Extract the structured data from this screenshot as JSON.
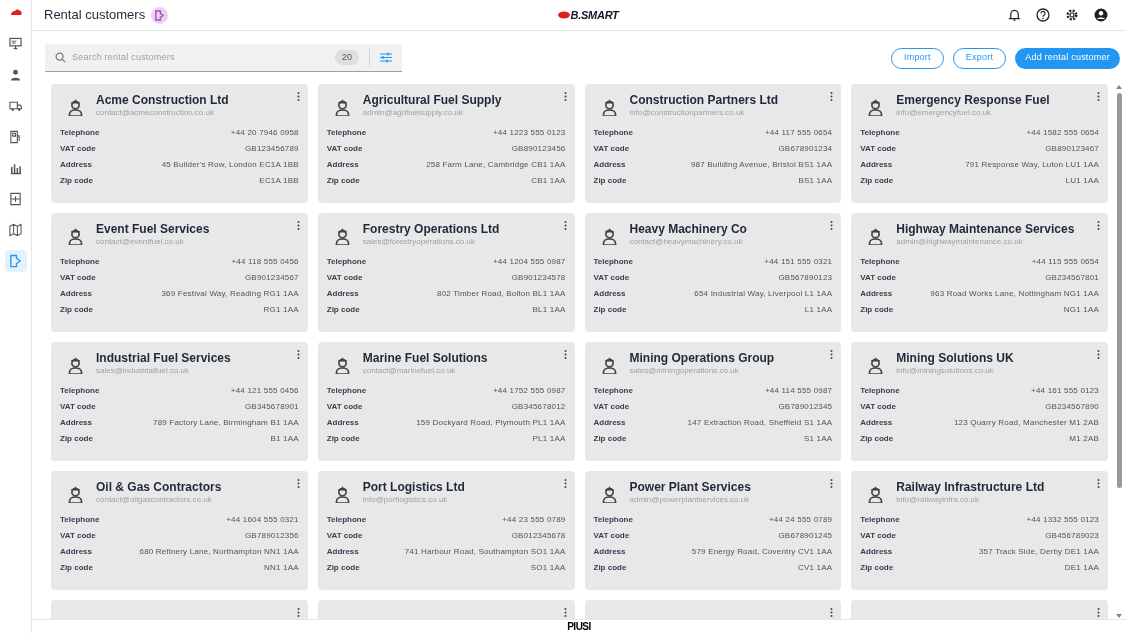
{
  "sidebar": {
    "items": [
      {
        "selected": false
      },
      {
        "selected": false
      },
      {
        "selected": false
      },
      {
        "selected": false
      },
      {
        "selected": false
      },
      {
        "selected": false
      },
      {
        "selected": false
      },
      {
        "selected": true
      }
    ]
  },
  "header": {
    "title": "Rental customers",
    "logo": "B.SMART"
  },
  "toolbar": {
    "search": {
      "placeholder": "Search rental customers",
      "count": "20"
    },
    "buttons": [
      {
        "label": "Import",
        "kind": "outline"
      },
      {
        "label": "Export",
        "kind": "outline"
      },
      {
        "label": "Add rental customer",
        "kind": "primary"
      }
    ]
  },
  "customers": [
    {
      "name": "Acme Construction Ltd",
      "email": "contact@acmeconstruction.co.uk",
      "fields": [
        {
          "label": "Telephone",
          "value": "+44 20 7946 0958"
        },
        {
          "label": "VAT code",
          "value": "GB123456789"
        },
        {
          "label": "Address",
          "value": "45 Builder's Row, London EC1A 1BB"
        },
        {
          "label": "Zip code",
          "value": "EC1A 1BB"
        }
      ]
    },
    {
      "name": "Agricultural Fuel Supply",
      "email": "admin@agrifuelsupply.co.uk",
      "fields": [
        {
          "label": "Telephone",
          "value": "+44 1223 555 0123"
        },
        {
          "label": "VAT code",
          "value": "GB890123456"
        },
        {
          "label": "Address",
          "value": "258 Farm Lane, Cambridge CB1 1AA"
        },
        {
          "label": "Zip code",
          "value": "CB1 1AA"
        }
      ]
    },
    {
      "name": "Construction Partners Ltd",
      "email": "info@constructionpartners.co.uk",
      "fields": [
        {
          "label": "Telephone",
          "value": "+44 117 555 0654"
        },
        {
          "label": "VAT code",
          "value": "GB678901234"
        },
        {
          "label": "Address",
          "value": "987 Building Avenue, Bristol BS1 1AA"
        },
        {
          "label": "Zip code",
          "value": "BS1 1AA"
        }
      ]
    },
    {
      "name": "Emergency Response Fuel",
      "email": "info@emergencyfuel.co.uk",
      "fields": [
        {
          "label": "Telephone",
          "value": "+44 1582 555 0654"
        },
        {
          "label": "VAT code",
          "value": "GB890123467"
        },
        {
          "label": "Address",
          "value": "791 Response Way, Luton LU1 1AA"
        },
        {
          "label": "Zip code",
          "value": "LU1 1AA"
        }
      ]
    },
    {
      "name": "Event Fuel Services",
      "email": "contact@eventfuel.co.uk",
      "fields": [
        {
          "label": "Telephone",
          "value": "+44 118 555 0456"
        },
        {
          "label": "VAT code",
          "value": "GB901234567"
        },
        {
          "label": "Address",
          "value": "369 Festival Way, Reading RG1 1AA"
        },
        {
          "label": "Zip code",
          "value": "RG1 1AA"
        }
      ]
    },
    {
      "name": "Forestry Operations Ltd",
      "email": "sales@forestryoperations.co.uk",
      "fields": [
        {
          "label": "Telephone",
          "value": "+44 1204 555 0987"
        },
        {
          "label": "VAT code",
          "value": "GB901234578"
        },
        {
          "label": "Address",
          "value": "802 Timber Road, Bolton BL1 1AA"
        },
        {
          "label": "Zip code",
          "value": "BL1 1AA"
        }
      ]
    },
    {
      "name": "Heavy Machinery Co",
      "email": "contact@heavymachinery.co.uk",
      "fields": [
        {
          "label": "Telephone",
          "value": "+44 151 555 0321"
        },
        {
          "label": "VAT code",
          "value": "GB567890123"
        },
        {
          "label": "Address",
          "value": "654 Industrial Way, Liverpool L1 1AA"
        },
        {
          "label": "Zip code",
          "value": "L1 1AA"
        }
      ]
    },
    {
      "name": "Highway Maintenance Services",
      "email": "admin@highwaymaintenance.co.uk",
      "fields": [
        {
          "label": "Telephone",
          "value": "+44 115 555 0654"
        },
        {
          "label": "VAT code",
          "value": "GB234567801"
        },
        {
          "label": "Address",
          "value": "963 Road Works Lane, Nottingham NG1 1AA"
        },
        {
          "label": "Zip code",
          "value": "NG1 1AA"
        }
      ]
    },
    {
      "name": "Industrial Fuel Services",
      "email": "sales@industrialfuel.co.uk",
      "fields": [
        {
          "label": "Telephone",
          "value": "+44 121 555 0456"
        },
        {
          "label": "VAT code",
          "value": "GB345678901"
        },
        {
          "label": "Address",
          "value": "789 Factory Lane, Birmingham B1 1AA"
        },
        {
          "label": "Zip code",
          "value": "B1 1AA"
        }
      ]
    },
    {
      "name": "Marine Fuel Solutions",
      "email": "contact@marinefuel.co.uk",
      "fields": [
        {
          "label": "Telephone",
          "value": "+44 1752 555 0987"
        },
        {
          "label": "VAT code",
          "value": "GB345678012"
        },
        {
          "label": "Address",
          "value": "159 Dockyard Road, Plymouth PL1 1AA"
        },
        {
          "label": "Zip code",
          "value": "PL1 1AA"
        }
      ]
    },
    {
      "name": "Mining Operations Group",
      "email": "sales@miningoperations.co.uk",
      "fields": [
        {
          "label": "Telephone",
          "value": "+44 114 555 0987"
        },
        {
          "label": "VAT code",
          "value": "GB789012345"
        },
        {
          "label": "Address",
          "value": "147 Extraction Road, Sheffield S1 1AA"
        },
        {
          "label": "Zip code",
          "value": "S1 1AA"
        }
      ]
    },
    {
      "name": "Mining Solutions UK",
      "email": "info@miningsolutions.co.uk",
      "fields": [
        {
          "label": "Telephone",
          "value": "+44 161 555 0123"
        },
        {
          "label": "VAT code",
          "value": "GB234567890"
        },
        {
          "label": "Address",
          "value": "123 Quarry Road, Manchester M1 2AB"
        },
        {
          "label": "Zip code",
          "value": "M1 2AB"
        }
      ]
    },
    {
      "name": "Oil & Gas Contractors",
      "email": "contact@oilgascontractors.co.uk",
      "fields": [
        {
          "label": "Telephone",
          "value": "+44 1604 555 0321"
        },
        {
          "label": "VAT code",
          "value": "GB789012356"
        },
        {
          "label": "Address",
          "value": "680 Refinery Lane, Northampton NN1 1AA"
        },
        {
          "label": "Zip code",
          "value": "NN1 1AA"
        }
      ]
    },
    {
      "name": "Port Logistics Ltd",
      "email": "info@portlogistics.co.uk",
      "fields": [
        {
          "label": "Telephone",
          "value": "+44 23 555 0789"
        },
        {
          "label": "VAT code",
          "value": "GB012345678"
        },
        {
          "label": "Address",
          "value": "741 Harbour Road, Southampton SO1 1AA"
        },
        {
          "label": "Zip code",
          "value": "SO1 1AA"
        }
      ]
    },
    {
      "name": "Power Plant Services",
      "email": "admin@powerplantservices.co.uk",
      "fields": [
        {
          "label": "Telephone",
          "value": "+44 24 555 0789"
        },
        {
          "label": "VAT code",
          "value": "GB678901245"
        },
        {
          "label": "Address",
          "value": "579 Energy Road, Coventry CV1 1AA"
        },
        {
          "label": "Zip code",
          "value": "CV1 1AA"
        }
      ]
    },
    {
      "name": "Railway Infrastructure Ltd",
      "email": "info@railwayinfra.co.uk",
      "fields": [
        {
          "label": "Telephone",
          "value": "+44 1332 555 0123"
        },
        {
          "label": "VAT code",
          "value": "GB456789023"
        },
        {
          "label": "Address",
          "value": "357 Track Side, Derby DE1 1AA"
        },
        {
          "label": "Zip code",
          "value": "DE1 1AA"
        }
      ]
    }
  ],
  "footer": {
    "logo": "PIUSI"
  }
}
